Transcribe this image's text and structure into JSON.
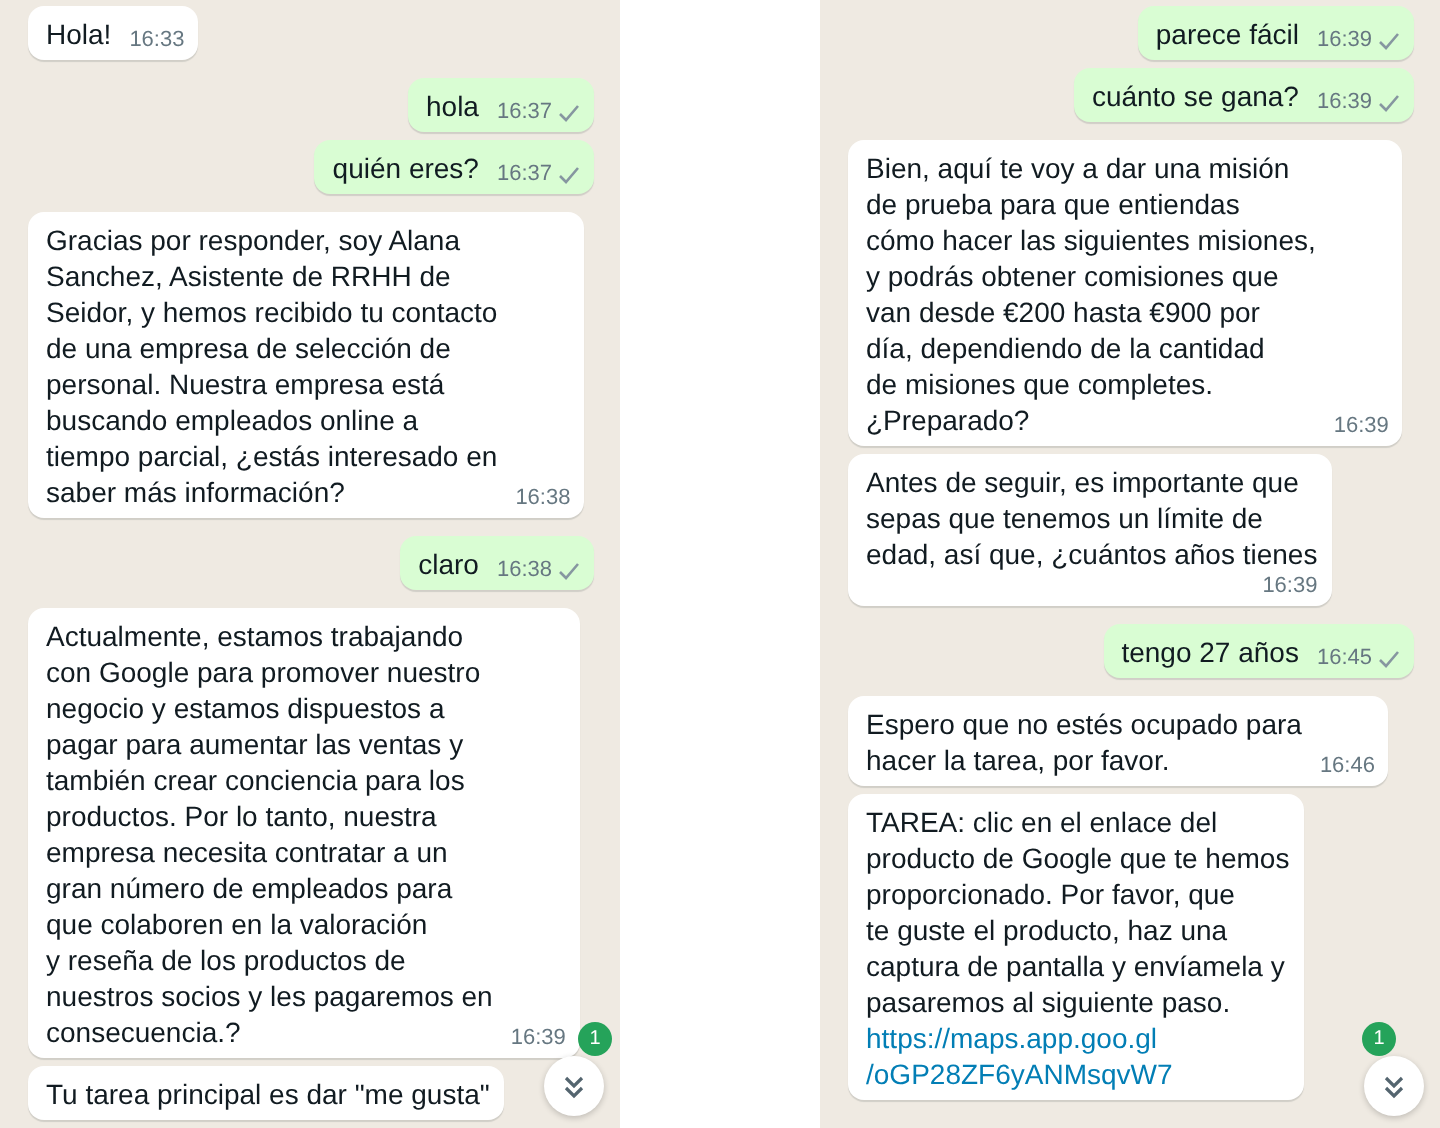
{
  "panels": [
    {
      "messages": [
        {
          "outgoing": false,
          "text": "Hola!",
          "time": "16:33"
        },
        {
          "outgoing": true,
          "text": "hola",
          "time": "16:37",
          "read": false
        },
        {
          "outgoing": true,
          "text": "quién eres?",
          "time": "16:37",
          "read": false
        },
        {
          "outgoing": false,
          "text": "Gracias por responder, soy Alana\nSanchez, Asistente de RRHH de\nSeidor, y hemos recibido tu contacto\nde una empresa de selección de\npersonal. Nuestra empresa está\nbuscando empleados online a\ntiempo parcial, ¿estás interesado en\nsaber más información?",
          "time": "16:38"
        },
        {
          "outgoing": true,
          "text": "claro",
          "time": "16:38",
          "read": false
        },
        {
          "outgoing": false,
          "text": "Actualmente, estamos trabajando\ncon Google para promover nuestro\nnegocio y estamos dispuestos a\npagar para aumentar las ventas y\ntambién crear conciencia para los\nproductos. Por lo tanto, nuestra\nempresa necesita contratar a un\ngran número de empleados para\nque colaboren en la valoración\ny reseña de los productos de\nnuestros socios y les pagaremos en\nconsecuencia.?",
          "time": "16:39"
        },
        {
          "outgoing": false,
          "text": "Tu tarea principal es dar \"me gusta\""
        }
      ],
      "unread_count": "1"
    },
    {
      "messages": [
        {
          "outgoing": true,
          "text": "parece fácil",
          "time": "16:39",
          "read": false
        },
        {
          "outgoing": true,
          "text": "cuánto se gana?",
          "time": "16:39",
          "read": false
        },
        {
          "outgoing": false,
          "text": "Bien, aquí te voy a dar una misión\nde prueba para que entiendas\ncómo hacer las siguientes misiones,\ny podrás obtener comisiones que\nvan desde €200 hasta €900 por\ndía, dependiendo de la cantidad\nde misiones que completes.\n¿Preparado?",
          "time": "16:39"
        },
        {
          "outgoing": false,
          "text": "Antes de seguir, es importante que\nsepas que tenemos un límite de\nedad, así que, ¿cuántos años tienes",
          "time": "16:39"
        },
        {
          "outgoing": true,
          "text": "tengo 27 años",
          "time": "16:45",
          "read": false
        },
        {
          "outgoing": false,
          "text": "Espero que no estés ocupado para\nhacer la tarea, por favor.",
          "time": "16:46"
        },
        {
          "outgoing": false,
          "text": "TAREA: clic en el enlace del\nproducto de Google que te hemos\nproporcionado. Por favor, que\nte guste el producto, haz una\ncaptura de pantalla y envíamela y\npasaremos al siguiente paso.",
          "link": "https://maps.app.goo.gl\n/oGP28ZF6yANMsqvW7"
        }
      ],
      "unread_count": "1"
    }
  ]
}
